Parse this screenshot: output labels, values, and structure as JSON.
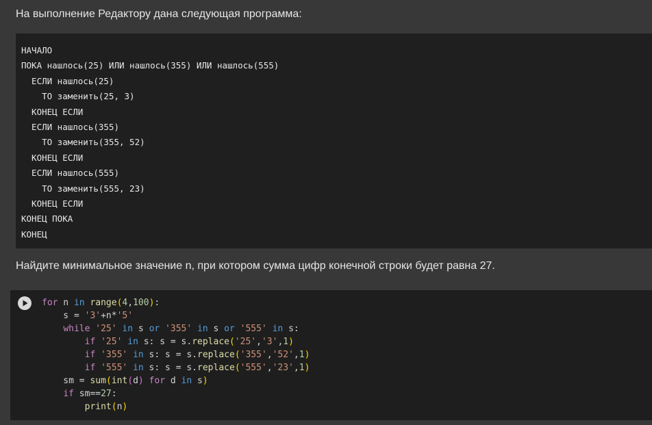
{
  "intro_text": "На выполнение Редактору дана следующая программа:",
  "pseudocode": [
    "НАЧАЛО",
    "ПОКА нашлось(25) ИЛИ нашлось(355) ИЛИ нашлось(555)",
    "  ЕСЛИ нашлось(25)",
    "    ТО заменить(25, 3)",
    "  КОНЕЦ ЕСЛИ",
    "  ЕСЛИ нашлось(355)",
    "    ТО заменить(355, 52)",
    "  КОНЕЦ ЕСЛИ",
    "  ЕСЛИ нашлось(555)",
    "    ТО заменить(555, 23)",
    "  КОНЕЦ ЕСЛИ",
    "КОНЕЦ ПОКА",
    "КОНЕЦ"
  ],
  "question_text": "Найдите минимальное значение n, при котором сумма цифр конечной строки будет равна 27.",
  "code_cell": {
    "run_button_icon": "play-icon",
    "lines": [
      [
        [
          "kw",
          "for"
        ],
        [
          "var",
          " n "
        ],
        [
          "op",
          "in"
        ],
        [
          "var",
          " "
        ],
        [
          "fn",
          "range"
        ],
        [
          "p1",
          "("
        ],
        [
          "num",
          "4"
        ],
        [
          "var",
          ","
        ],
        [
          "num",
          "100"
        ],
        [
          "p1",
          ")"
        ],
        [
          "var",
          ":"
        ]
      ],
      [
        [
          "var",
          "    s = "
        ],
        [
          "str",
          "'3'"
        ],
        [
          "var",
          "+n*"
        ],
        [
          "str",
          "'5'"
        ]
      ],
      [
        [
          "var",
          "    "
        ],
        [
          "kw",
          "while"
        ],
        [
          "var",
          " "
        ],
        [
          "str",
          "'25'"
        ],
        [
          "var",
          " "
        ],
        [
          "op",
          "in"
        ],
        [
          "var",
          " s "
        ],
        [
          "op",
          "or"
        ],
        [
          "var",
          " "
        ],
        [
          "str",
          "'355'"
        ],
        [
          "var",
          " "
        ],
        [
          "op",
          "in"
        ],
        [
          "var",
          " s "
        ],
        [
          "op",
          "or"
        ],
        [
          "var",
          " "
        ],
        [
          "str",
          "'555'"
        ],
        [
          "var",
          " "
        ],
        [
          "op",
          "in"
        ],
        [
          "var",
          " s:"
        ]
      ],
      [
        [
          "var",
          "        "
        ],
        [
          "kw",
          "if"
        ],
        [
          "var",
          " "
        ],
        [
          "str",
          "'25'"
        ],
        [
          "var",
          " "
        ],
        [
          "op",
          "in"
        ],
        [
          "var",
          " s: s = s."
        ],
        [
          "fn",
          "replace"
        ],
        [
          "p1",
          "("
        ],
        [
          "str",
          "'25'"
        ],
        [
          "var",
          ","
        ],
        [
          "str",
          "'3'"
        ],
        [
          "var",
          ","
        ],
        [
          "num",
          "1"
        ],
        [
          "p1",
          ")"
        ]
      ],
      [
        [
          "var",
          "        "
        ],
        [
          "kw",
          "if"
        ],
        [
          "var",
          " "
        ],
        [
          "str",
          "'355'"
        ],
        [
          "var",
          " "
        ],
        [
          "op",
          "in"
        ],
        [
          "var",
          " s: s = s."
        ],
        [
          "fn",
          "replace"
        ],
        [
          "p1",
          "("
        ],
        [
          "str",
          "'355'"
        ],
        [
          "var",
          ","
        ],
        [
          "str",
          "'52'"
        ],
        [
          "var",
          ","
        ],
        [
          "num",
          "1"
        ],
        [
          "p1",
          ")"
        ]
      ],
      [
        [
          "var",
          "        "
        ],
        [
          "kw",
          "if"
        ],
        [
          "var",
          " "
        ],
        [
          "str",
          "'555'"
        ],
        [
          "var",
          " "
        ],
        [
          "op",
          "in"
        ],
        [
          "var",
          " s: s = s."
        ],
        [
          "fn",
          "replace"
        ],
        [
          "p1",
          "("
        ],
        [
          "str",
          "'555'"
        ],
        [
          "var",
          ","
        ],
        [
          "str",
          "'23'"
        ],
        [
          "var",
          ","
        ],
        [
          "num",
          "1"
        ],
        [
          "p1",
          ")"
        ]
      ],
      [
        [
          "var",
          "    sm = "
        ],
        [
          "fn",
          "sum"
        ],
        [
          "p1",
          "("
        ],
        [
          "fn",
          "int"
        ],
        [
          "p2",
          "("
        ],
        [
          "var",
          "d"
        ],
        [
          "p2",
          ")"
        ],
        [
          "var",
          " "
        ],
        [
          "kw",
          "for"
        ],
        [
          "var",
          " d "
        ],
        [
          "op",
          "in"
        ],
        [
          "var",
          " s"
        ],
        [
          "p1",
          ")"
        ]
      ],
      [
        [
          "var",
          "    "
        ],
        [
          "kw",
          "if"
        ],
        [
          "var",
          " sm=="
        ],
        [
          "num",
          "27"
        ],
        [
          "var",
          ":"
        ]
      ],
      [
        [
          "var",
          "        "
        ],
        [
          "fn",
          "print"
        ],
        [
          "p1",
          "("
        ],
        [
          "var",
          "n"
        ],
        [
          "p1",
          ")"
        ]
      ]
    ]
  }
}
